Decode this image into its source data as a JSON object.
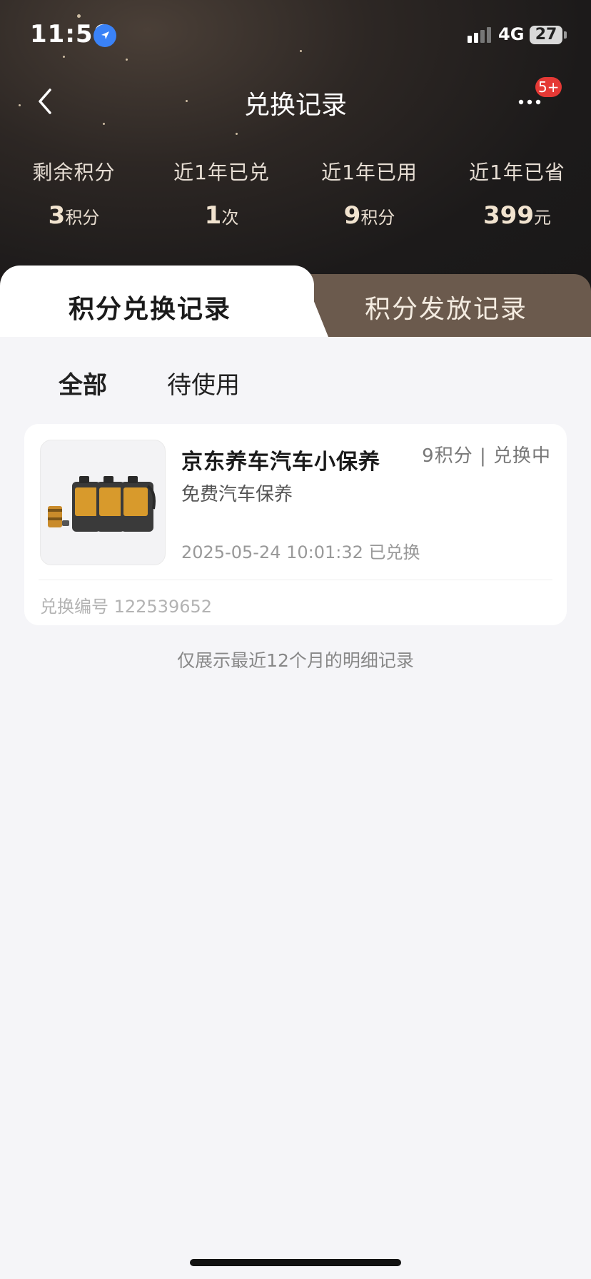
{
  "status_bar": {
    "time": "11:56",
    "network": "4G",
    "battery": "27"
  },
  "nav": {
    "title": "兑换记录",
    "badge": "5+"
  },
  "stats": [
    {
      "label": "剩余积分",
      "value": "3",
      "unit": "积分"
    },
    {
      "label": "近1年已兑",
      "value": "1",
      "unit": "次"
    },
    {
      "label": "近1年已用",
      "value": "9",
      "unit": "积分"
    },
    {
      "label": "近1年已省",
      "value": "399",
      "unit": "元"
    }
  ],
  "tabs": {
    "active": "积分兑换记录",
    "inactive": "积分发放记录"
  },
  "filters": {
    "all": "全部",
    "pending": "待使用"
  },
  "record": {
    "name": "京东养车汽车小保养",
    "subtitle": "免费汽车保养",
    "points_status": "9积分 | 兑换中",
    "datetime": "2025-05-24 10:01:32 已兑换",
    "order_label": "兑换编号 122539652"
  },
  "footer_note": "仅展示最近12个月的明细记录",
  "colors": {
    "header_bg": "#1c1a1a",
    "inactive_tab": "#6b5a4d",
    "accent_underline": "#d6b99c",
    "badge": "#e53935"
  }
}
